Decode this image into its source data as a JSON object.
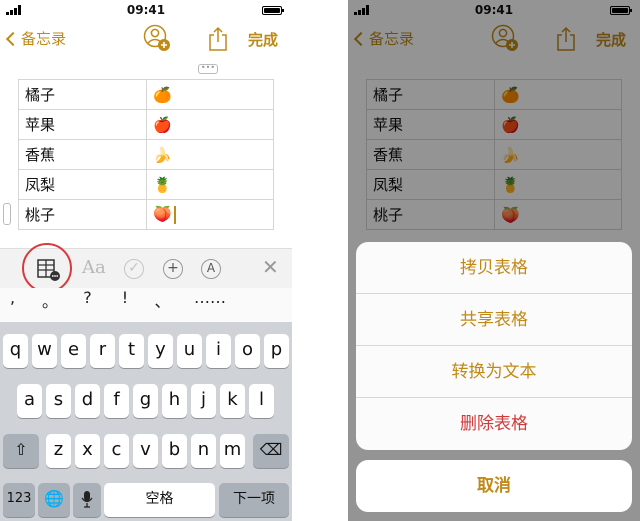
{
  "status": {
    "time": "09:41"
  },
  "nav": {
    "back_label": "备忘录",
    "done_label": "完成"
  },
  "table": {
    "rows": [
      {
        "name": "橘子",
        "emoji": "🍊"
      },
      {
        "name": "苹果",
        "emoji": "🍎"
      },
      {
        "name": "香蕉",
        "emoji": "🍌"
      },
      {
        "name": "凤梨",
        "emoji": "🍍"
      },
      {
        "name": "桃子",
        "emoji": "🍑"
      }
    ]
  },
  "format_bar": {
    "text_style": "Aa"
  },
  "punctuation": [
    ",",
    "。",
    "?",
    "!",
    "、",
    "……"
  ],
  "keyboard": {
    "row1": [
      "q",
      "w",
      "e",
      "r",
      "t",
      "y",
      "u",
      "i",
      "o",
      "p"
    ],
    "row2": [
      "a",
      "s",
      "d",
      "f",
      "g",
      "h",
      "j",
      "k",
      "l"
    ],
    "row3": [
      "z",
      "x",
      "c",
      "v",
      "b",
      "n",
      "m"
    ],
    "numbers_label": "123",
    "space_label": "空格",
    "next_label": "下一项"
  },
  "action_sheet": {
    "options": [
      "拷贝表格",
      "共享表格",
      "转换为文本",
      "删除表格"
    ],
    "cancel_label": "取消"
  },
  "colors": {
    "accent": "#c08a17",
    "danger": "#d13a3a",
    "highlight": "#d8393f"
  }
}
